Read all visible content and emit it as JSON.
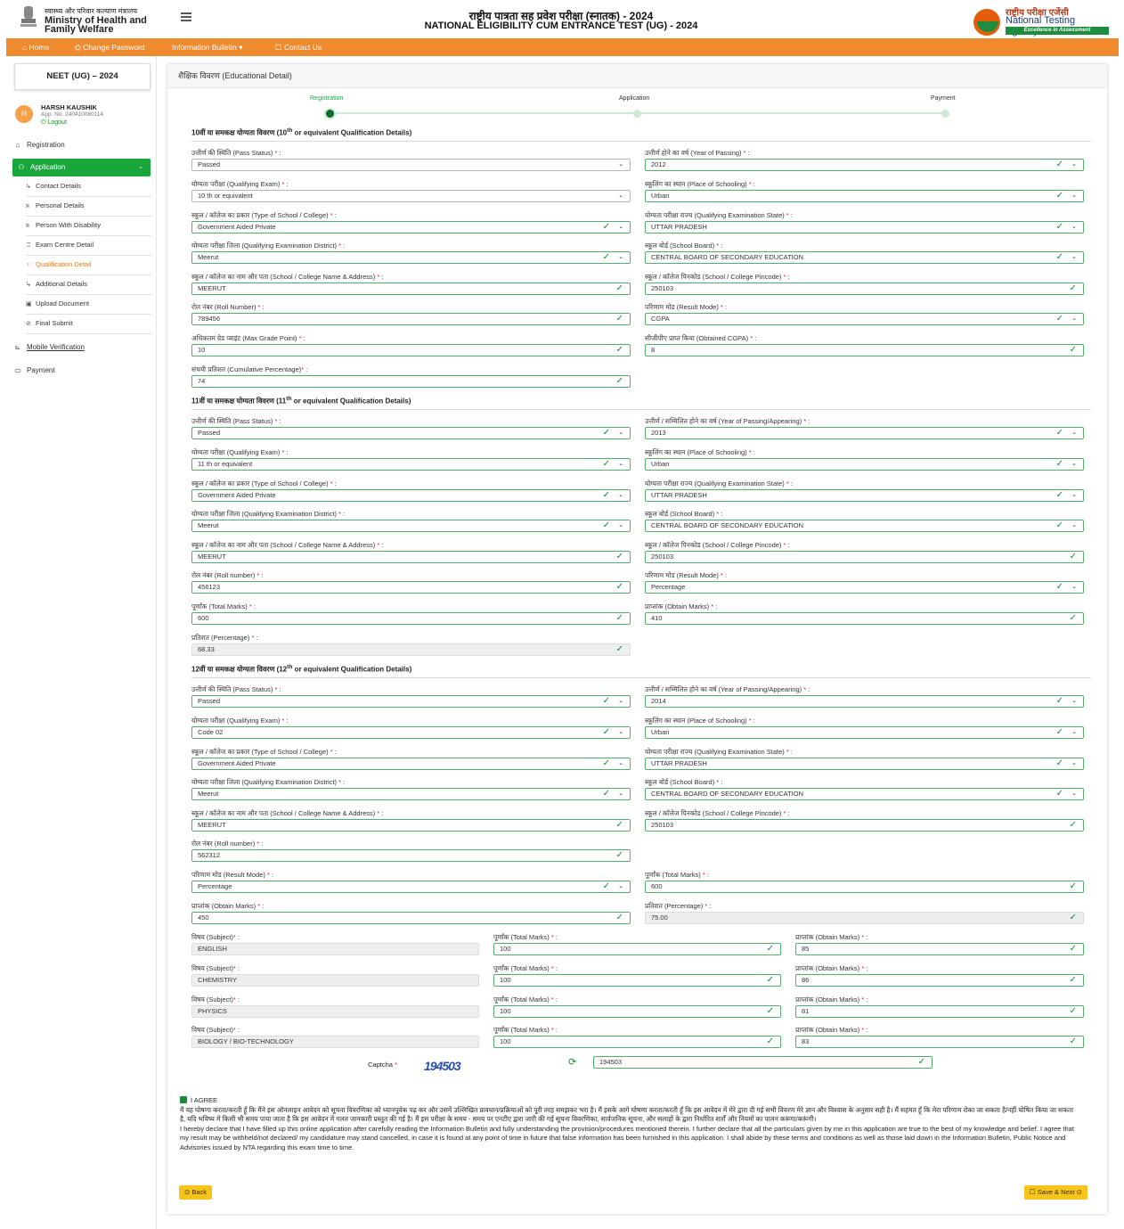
{
  "header": {
    "ministry_hi": "स्वास्थ्य और परिवार कल्याण मंत्रालय",
    "ministry_en_1": "Ministry of Health and",
    "ministry_en_2": "Family Welfare",
    "title_hi": "राष्ट्रीय पात्रता सह प्रवेश परीक्षा (स्नातक) - 2024",
    "title_en": "NATIONAL ELIGIBILITY CUM ENTRANCE TEST (UG) - 2024",
    "nta_hi": "राष्ट्रीय परीक्षा एजेंसी",
    "nta_en": "National Testing Agency",
    "nta_tag": "Excellence in Assessment"
  },
  "nav": {
    "home": "⌂ Home",
    "change_password": "⛭ Change Password",
    "info_bulletin": "Information Bulletin ▾",
    "contact": "☐ Contact Us"
  },
  "sidebar": {
    "exam": "NEET (UG) – 2024",
    "user_initial": "H",
    "user_name": "HARSH KAUSHIK",
    "app_no": "App. No. 240410080114",
    "logout": "⏻ Logout",
    "registration": "Registration",
    "application": "Application",
    "items": [
      "Contact Details",
      "Personal Details",
      "Person With Disability",
      "Exam Centre Detail",
      "Qualification Detail",
      "Additional Details",
      "Upload Document",
      "Final Submit"
    ],
    "mobile": "Mobile Verification",
    "payment": "Payment"
  },
  "main": {
    "heading": "शैक्षिक विवरण (Educational Detail)",
    "steps": [
      "Registration",
      "Application",
      "Payment"
    ]
  },
  "sections": {
    "s10": {
      "hi": "10वीं या समकक्ष योग्यता विवरण (10",
      "sup": "th",
      "en": " or equivalent Qualification Details)"
    },
    "s11": {
      "hi": "11वीं या समकक्ष योग्यता विवरण (11",
      "sup": "th",
      "en": " or equivalent Qualification Details)"
    },
    "s12": {
      "hi": "12वीं या समकक्ष योग्यता विवरण (12",
      "sup": "th",
      "en": " or equivalent Qualification Details)"
    }
  },
  "labels": {
    "pass_status": "उत्तीर्ण की स्थिति (Pass Status)",
    "year_passing": "उत्तीर्ण होने का वर्ष (Year of Passing)",
    "year_passing_app": "उत्तीर्ण / सम्मिलित होने का वर्ष (Year of Passing/Appearing)",
    "qual_exam": "योग्यता परीक्षा (Qualifying Exam)",
    "place_school": "स्कूलिंग का स्थान (Place of Schooling)",
    "type_school": "स्कूल / कॉलेज का प्रकार (Type of School / College)",
    "qual_state": "योग्यता परीक्षा राज्य (Qualifying Examination State)",
    "qual_district": "योग्यता परीक्षा जिला (Qualifying Examination District)",
    "board": "स्कूल बोर्ड (School Board)",
    "school_name": "स्कूल / कॉलेज का नाम और पता (School / College Name & Address)",
    "pincode": "स्कूल / कॉलेज पिनकोड (School / College Pincode)",
    "roll_10": "रोल नंबर (Roll Number)",
    "roll": "रोल नंबर (Roll number)",
    "result_mode": "परिणाम मोड (Result Mode)",
    "max_grade": "अधिकतम ग्रेड प्वाइंट (Max Grade Point)",
    "obtained_cgpa": "सीजीपीए प्राप्त किया (Obtained CGPA)",
    "cumulative": "संचयी प्रतिशत (Cumulative Percentage)",
    "total_marks": "पूर्णांक (Total Marks)",
    "obtain_marks": "प्राप्तांक (Obtain Marks)",
    "percentage": "प्रतिशत (Percentage)",
    "subject": "विषय (Subject)",
    "captcha": "Captcha"
  },
  "ten": {
    "pass_status": "Passed",
    "year": "2012",
    "qual_exam": "10 th or equivalent",
    "place": "Urban",
    "type": "Government Aided Private",
    "state": "UTTAR PRADESH",
    "district": "Meerut",
    "board": "CENTRAL BOARD OF SECONDARY EDUCATION",
    "school": "MEERUT",
    "pincode": "250103",
    "roll": "789456",
    "result_mode": "CGPA",
    "max_grade": "10",
    "cgpa": "8",
    "cumulative": "74"
  },
  "eleven": {
    "pass_status": "Passed",
    "year": "2013",
    "qual_exam": "11 th or equivalent",
    "place": "Urban",
    "type": "Government Aided Private",
    "state": "UTTAR PRADESH",
    "district": "Meerut",
    "board": "CENTRAL BOARD OF SECONDARY EDUCATION",
    "school": "MEERUT",
    "pincode": "250103",
    "roll": "456123",
    "result_mode": "Percentage",
    "total": "600",
    "obtain": "410",
    "percentage": "68.33"
  },
  "twelve": {
    "pass_status": "Passed",
    "year": "2014",
    "qual_exam": "Code 02",
    "place": "Urban",
    "type": "Government Aided Private",
    "state": "UTTAR PRADESH",
    "district": "Meerut",
    "board": "CENTRAL BOARD OF SECONDARY EDUCATION",
    "school": "MEERUT",
    "pincode": "250103",
    "roll": "562312",
    "result_mode": "Percentage",
    "total": "600",
    "obtain": "450",
    "percentage": "75.00",
    "subjects": [
      {
        "name": "ENGLISH",
        "total": "100",
        "obtain": "85"
      },
      {
        "name": "CHEMISTRY",
        "total": "100",
        "obtain": "86"
      },
      {
        "name": "PHYSICS",
        "total": "100",
        "obtain": "81"
      },
      {
        "name": "BIOLOGY / BIO-TECHNOLOGY",
        "total": "100",
        "obtain": "83"
      }
    ]
  },
  "captcha": {
    "image_text": "194503",
    "value": "194503"
  },
  "agree": {
    "label": "I AGREE",
    "hi": "मैं यह घोषणा करता/करती हूँ कि मैंने इस ऑनलाइन आवेदन को सूचना विवरणिका को ध्यानपूर्वक पढ़ कर और उसमें उल्लिखित प्रावधान/प्रक्रियाओं को पूरी तरह समझकर भरा है। मैं इसके आगे घोषणा करता/करती हूँ कि इस आवेदन में मेरे द्वारा दी गई सभी विवरण मेरे ज्ञान और विश्वास के अनुसार सही है। मैं सहमत हूँ कि मेरा परिणाम रोका जा सकता है/नहीं घोषित किया जा सकता है, यदि भविष्य में किसी भी समय पाया जाता है कि इस आवेदन में गलत जानकारी प्रस्तुत की गई है। मैं इस परीक्षा के समय - समय पर एनटीए द्वारा जारी की गई सूचना विवरणिका, सार्वजनिक सूचना, और सलाहों के द्वारा निर्धारित शर्तों और नियमों का पालन करूंगा/करूंगी।",
    "en": "I hereby declare that I have filled up this online application after carefully reading the Information Bulletin and fully understanding the provision/procedures mentioned therein. I further declare that all the particulars given by me in this application are true to the best of my knowledge and belief. I agree that my result may be withheld/not declared/ my candidature may stand cancelled, in case it is found at any point of time in future that false information has been furnished in this application. I shall abide by these terms and conditions as well as those laid down in the Information Bulletin, Public Notice and Advisories issued by NTA regarding this exam time to time."
  },
  "buttons": {
    "back": "⊙ Back",
    "save": "☐ Save & Next ⊙"
  }
}
